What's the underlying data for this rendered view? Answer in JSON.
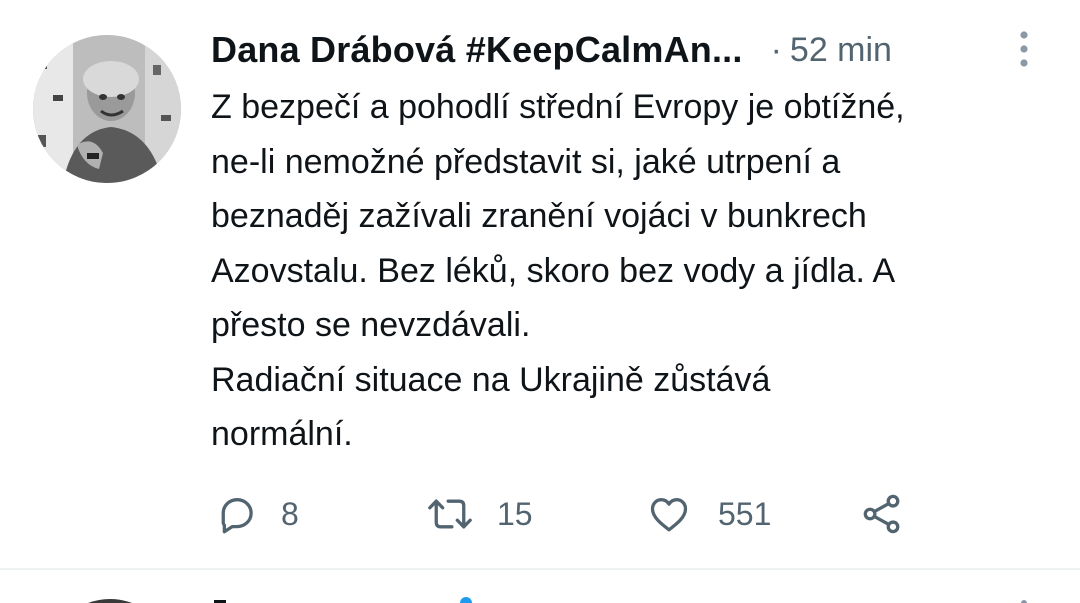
{
  "tweet": {
    "author_name": "Dana Drábová #KeepCalmAn...",
    "separator": "·",
    "time": "52 min",
    "avatar_icon": "user-avatar-photo",
    "more_icon": "more-vertical-icon",
    "text_lines": [
      "Z bezpečí a pohodlí střední Evropy je obtížné,",
      "ne-li nemožné představit si, jaké utrpení a",
      "beznaděj zažívali zranění vojáci v bunkrech",
      "Azovstalu. Bez léků, skoro bez vody a jídla. A",
      "přesto se nevzdávali.",
      "Radiační situace na Ukrajině zůstává",
      "normální."
    ],
    "actions": {
      "reply": {
        "icon": "reply-icon",
        "count": "8"
      },
      "retweet": {
        "icon": "retweet-icon",
        "count": "15"
      },
      "like": {
        "icon": "heart-icon",
        "count": "551"
      },
      "share": {
        "icon": "share-icon"
      }
    }
  },
  "colors": {
    "text_primary": "#0f1419",
    "text_secondary": "#536471",
    "divider": "#eff3f4",
    "verified_blue": "#1d9bf0"
  }
}
